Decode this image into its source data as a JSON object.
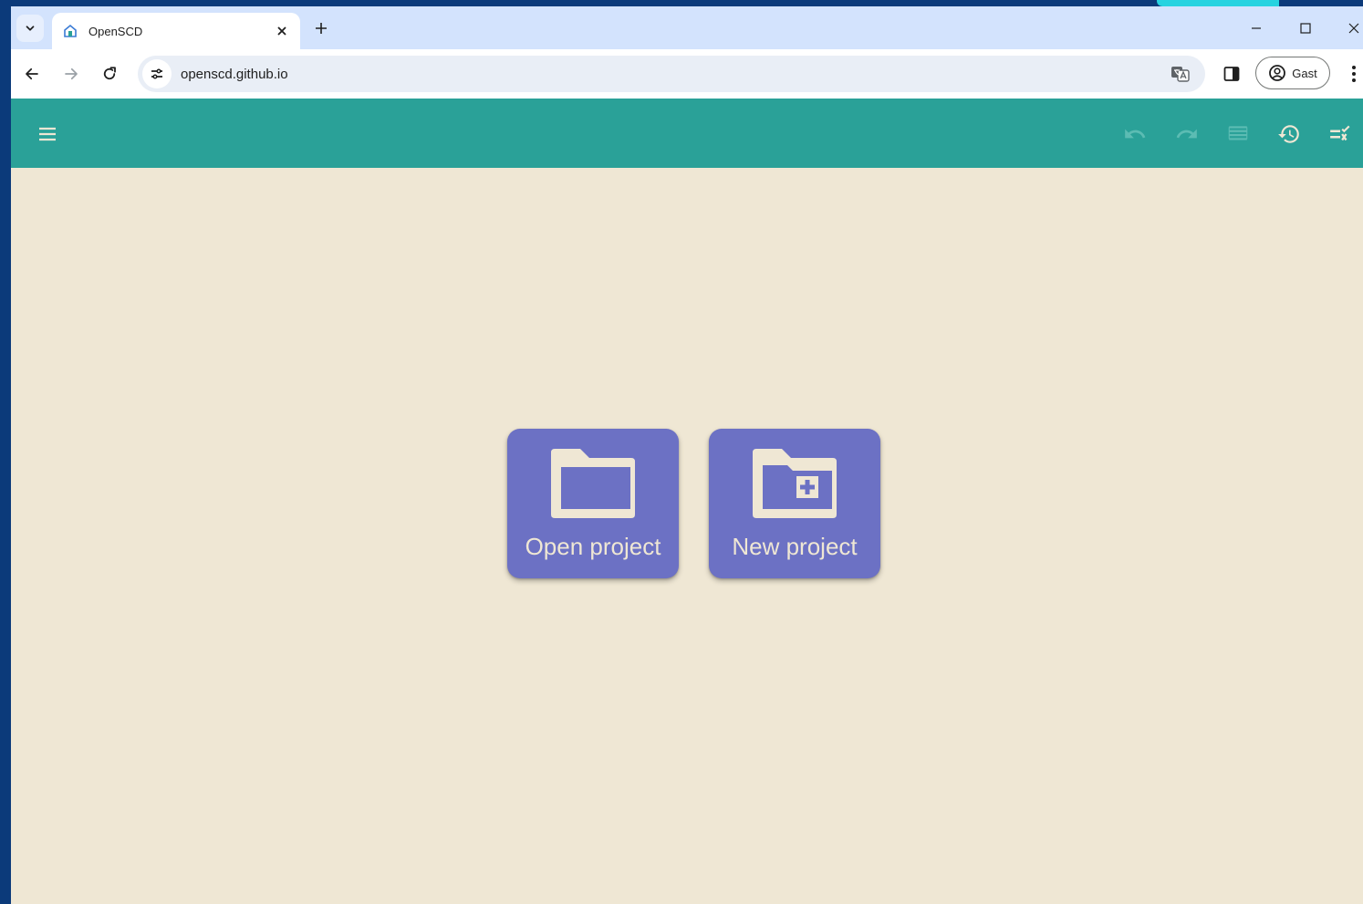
{
  "browser": {
    "tab": {
      "title": "OpenSCD"
    },
    "address_bar": {
      "url": "openscd.github.io"
    },
    "profile": {
      "label": "Gast"
    }
  },
  "app_bar": {
    "icons": [
      "menu-icon",
      "undo-icon",
      "redo-icon",
      "log-icon",
      "history-icon",
      "diagnostics-icon"
    ]
  },
  "main": {
    "actions": [
      {
        "label": "Open project",
        "icon": "folder-icon"
      },
      {
        "label": "New project",
        "icon": "create-new-folder-icon"
      }
    ]
  },
  "colors": {
    "app_bar": "#2aa198",
    "background": "#efe7d4",
    "card": "#6c71c4",
    "desktop": "#0b3a7a",
    "tabstrip": "#d3e3fd"
  }
}
